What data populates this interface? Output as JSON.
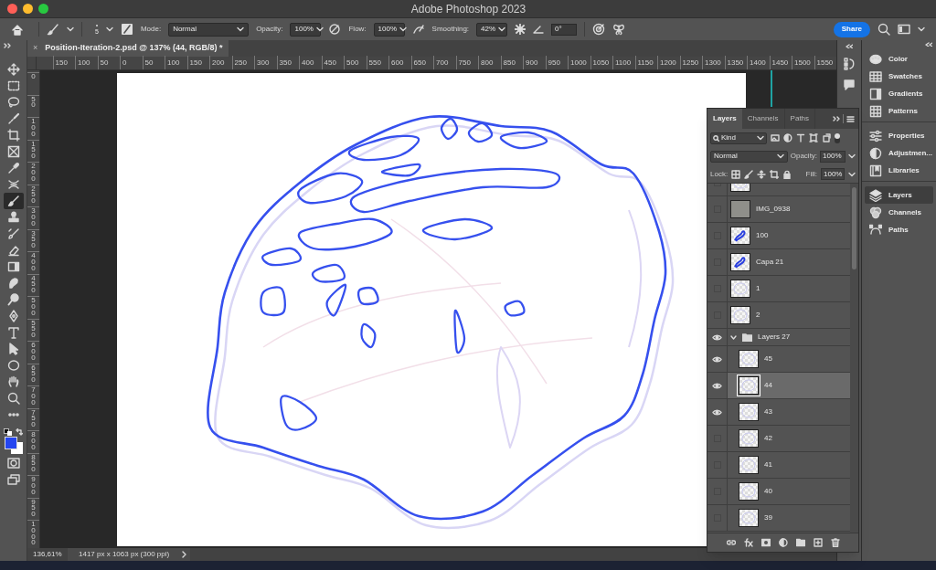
{
  "window": {
    "title": "Adobe Photoshop 2023"
  },
  "options_bar": {
    "brush_size": "5",
    "mode_label": "Mode:",
    "mode": "Normal",
    "opacity_label": "Opacity:",
    "opacity": "100%",
    "flow_label": "Flow:",
    "flow": "100%",
    "smoothing_label": "Smoothing:",
    "smoothing": "42%",
    "angle": "0°",
    "share": "Share"
  },
  "document_tab": {
    "title": "Position-Iteration-2.psd @ 137% (44, RGB/8) *",
    "close": "×"
  },
  "rulers": {
    "horizontal": [
      "150",
      "100",
      "50",
      "0",
      "50",
      "100",
      "150",
      "200",
      "250",
      "300",
      "350",
      "400",
      "450",
      "500",
      "550",
      "600",
      "650",
      "700",
      "750",
      "800",
      "850",
      "900",
      "950",
      "1000",
      "1050",
      "1100",
      "1150",
      "1200",
      "1250",
      "1300",
      "1350",
      "1400",
      "1450",
      "1500",
      "1550"
    ],
    "vertical": [
      "0",
      "50",
      "100",
      "150",
      "200",
      "250",
      "300",
      "350",
      "400",
      "450",
      "500",
      "550",
      "600",
      "650",
      "700",
      "750",
      "800",
      "850",
      "900",
      "950",
      "1000"
    ]
  },
  "tools": [
    {
      "selected": false
    },
    {
      "selected": false
    },
    {
      "selected": false
    },
    {
      "selected": false
    },
    {
      "selected": false
    },
    {
      "selected": false
    },
    {
      "selected": false
    },
    {
      "selected": false
    },
    {
      "selected": true
    },
    {
      "selected": false
    },
    {
      "selected": false
    },
    {
      "selected": false
    },
    {
      "selected": false
    },
    {
      "selected": false
    },
    {
      "selected": false
    },
    {
      "selected": false
    },
    {
      "selected": false
    },
    {
      "selected": false
    },
    {
      "selected": false
    },
    {
      "selected": false
    },
    {
      "selected": false
    },
    {
      "selected": false
    }
  ],
  "layers_panel": {
    "tabs": [
      {
        "label": "Layers",
        "selected": true
      },
      {
        "label": "Channels",
        "selected": false
      },
      {
        "label": "Paths",
        "selected": false
      }
    ],
    "filter": "Kind",
    "blend_mode": "Normal",
    "opacity_label": "Opacity:",
    "opacity": "100%",
    "lock_label": "Lock:",
    "fill_label": "Fill:",
    "fill": "100%",
    "layers": [
      {
        "kind": "layer",
        "visible": false,
        "selected": false
      },
      {
        "kind": "image",
        "name": "IMG_0938",
        "visible": false,
        "selected": false
      },
      {
        "kind": "drawing",
        "name": "100",
        "visible": false,
        "selected": false
      },
      {
        "kind": "drawing",
        "name": "Capa 21",
        "visible": false,
        "selected": false
      },
      {
        "kind": "layer",
        "name": "1",
        "visible": false,
        "selected": false
      },
      {
        "kind": "layer",
        "name": "2",
        "visible": false,
        "selected": false
      },
      {
        "kind": "group",
        "name": "Layers 27",
        "visible": true,
        "selected": false,
        "expanded": true,
        "children": [
          {
            "kind": "layer",
            "name": "45",
            "visible": true,
            "selected": false
          },
          {
            "kind": "layer",
            "name": "44",
            "visible": true,
            "selected": true
          },
          {
            "kind": "layer",
            "name": "43",
            "visible": true,
            "selected": false
          },
          {
            "kind": "layer",
            "name": "42",
            "visible": false,
            "selected": false
          },
          {
            "kind": "layer",
            "name": "41",
            "visible": false,
            "selected": false
          },
          {
            "kind": "layer",
            "name": "40",
            "visible": false,
            "selected": false
          },
          {
            "kind": "layer",
            "name": "39",
            "visible": false,
            "selected": false
          }
        ]
      }
    ]
  },
  "right_panels": [
    {
      "label": "Color",
      "selected": false
    },
    {
      "label": "Swatches",
      "selected": false
    },
    {
      "label": "Gradients",
      "selected": false
    },
    {
      "label": "Patterns",
      "selected": false
    },
    {
      "label": "Properties",
      "selected": false
    },
    {
      "label": "Adjustmen...",
      "selected": false
    },
    {
      "label": "Libraries",
      "selected": false
    },
    {
      "label": "Layers",
      "selected": true
    },
    {
      "label": "Channels",
      "selected": false
    },
    {
      "label": "Paths",
      "selected": false
    }
  ],
  "status_bar": {
    "zoom": "136,61%",
    "document_info": "1417 px x 1063 px (300 ppi)"
  }
}
